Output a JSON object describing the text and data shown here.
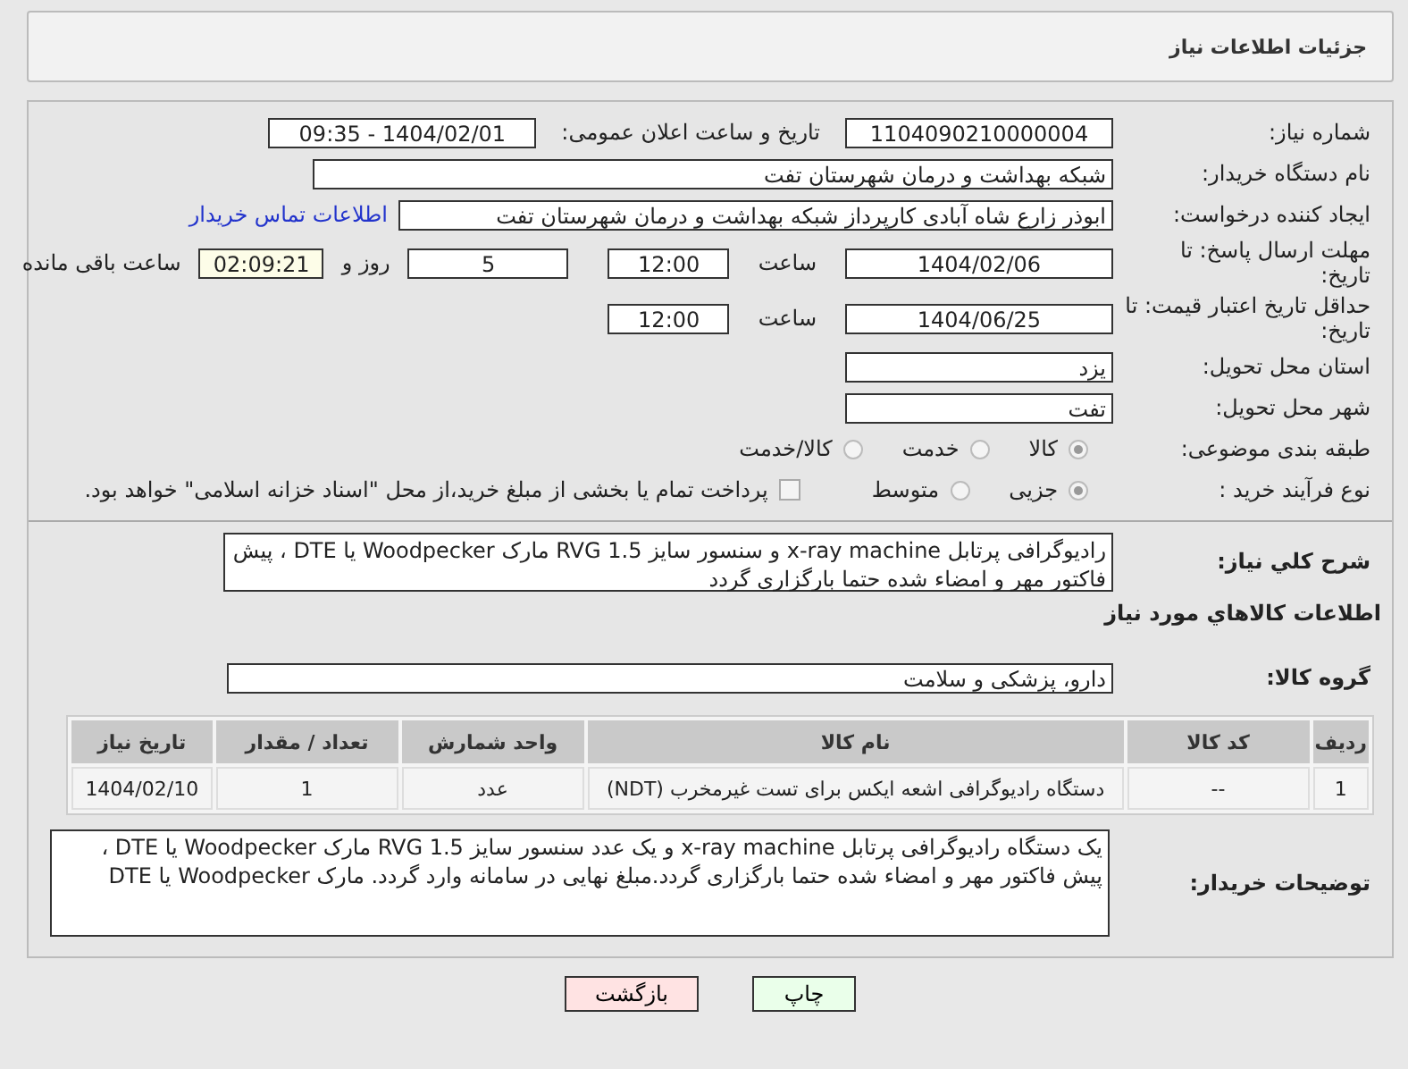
{
  "header": {
    "title": "جزئیات اطلاعات نیاز"
  },
  "fields": {
    "need_number": {
      "label": "شماره نیاز:",
      "value": "1104090210000004"
    },
    "announce": {
      "label": "تاریخ و ساعت اعلان عمومی:",
      "value": "1404/02/01 - 09:35"
    },
    "buyer": {
      "label": "نام دستگاه خریدار:",
      "value": "شبکه بهداشت و درمان شهرستان تفت"
    },
    "creator": {
      "label": "ایجاد کننده درخواست:",
      "value": "ابوذر زارع شاه آبادی کارپرداز شبکه بهداشت و درمان شهرستان تفت",
      "link": "اطلاعات تماس خریدار"
    },
    "deadline": {
      "label": "مهلت ارسال پاسخ: تا تاریخ:",
      "date": "1404/02/06",
      "time_label": "ساعت",
      "time": "12:00",
      "days": "5",
      "days_label": "روز و",
      "remaining": "02:09:21",
      "remaining_label": "ساعت باقی مانده"
    },
    "validity": {
      "label": "حداقل تاریخ اعتبار قیمت: تا تاریخ:",
      "date": "1404/06/25",
      "time_label": "ساعت",
      "time": "12:00"
    },
    "province": {
      "label": "استان محل تحویل:",
      "value": "یزد"
    },
    "city": {
      "label": "شهر محل تحویل:",
      "value": "تفت"
    }
  },
  "category": {
    "label": "طبقه بندی موضوعی:",
    "options": [
      {
        "label": "کالا",
        "selected": true
      },
      {
        "label": "خدمت",
        "selected": false
      },
      {
        "label": "کالا/خدمت",
        "selected": false
      }
    ]
  },
  "process": {
    "label": "نوع فرآیند خرید :",
    "options": [
      {
        "label": "جزیی",
        "selected": true
      },
      {
        "label": "متوسط",
        "selected": false
      }
    ],
    "checkbox": {
      "label": "پرداخت تمام یا بخشی از مبلغ خرید،از محل \"اسناد خزانه اسلامی\" خواهد بود.",
      "checked": false
    }
  },
  "description": {
    "label": "شرح کلي نیاز:",
    "value": "رادیوگرافی پرتابل   x-ray machine  و سنسور  سایز 1.5    RVG  مارک Woodpecker یا DTE ، پیش فاکتور مهر و امضاء شده حتما بارگزاری گردد"
  },
  "goods_heading": "اطلاعات کالاهاي مورد نیاز",
  "goods_group": {
    "label": "گروه کالا:",
    "value": "دارو، پزشکی و سلامت"
  },
  "table": {
    "columns": [
      "ردیف",
      "کد کالا",
      "نام کالا",
      "واحد شمارش",
      "تعداد / مقدار",
      "تاریخ نیاز"
    ],
    "rows": [
      [
        "1",
        "--",
        "دستگاه رادیوگرافی اشعه ایکس برای تست غیرمخرب (NDT)",
        "عدد",
        "1",
        "1404/02/10"
      ]
    ]
  },
  "buyer_notes": {
    "label": "توضیحات خریدار:",
    "value": "یک دستگاه رادیوگرافی پرتابل   x-ray machine  و یک عدد سنسور  سایز 1.5    RVG  مارک Woodpecker یا DTE ، پیش فاکتور مهر و امضاء شده حتما بارگزاری گردد.مبلغ نهایی در سامانه وارد گردد. مارک Woodpecker  یا   DTE"
  },
  "buttons": [
    {
      "label": "چاپ",
      "kind": "print"
    },
    {
      "label": "بازگشت",
      "kind": "back"
    }
  ]
}
